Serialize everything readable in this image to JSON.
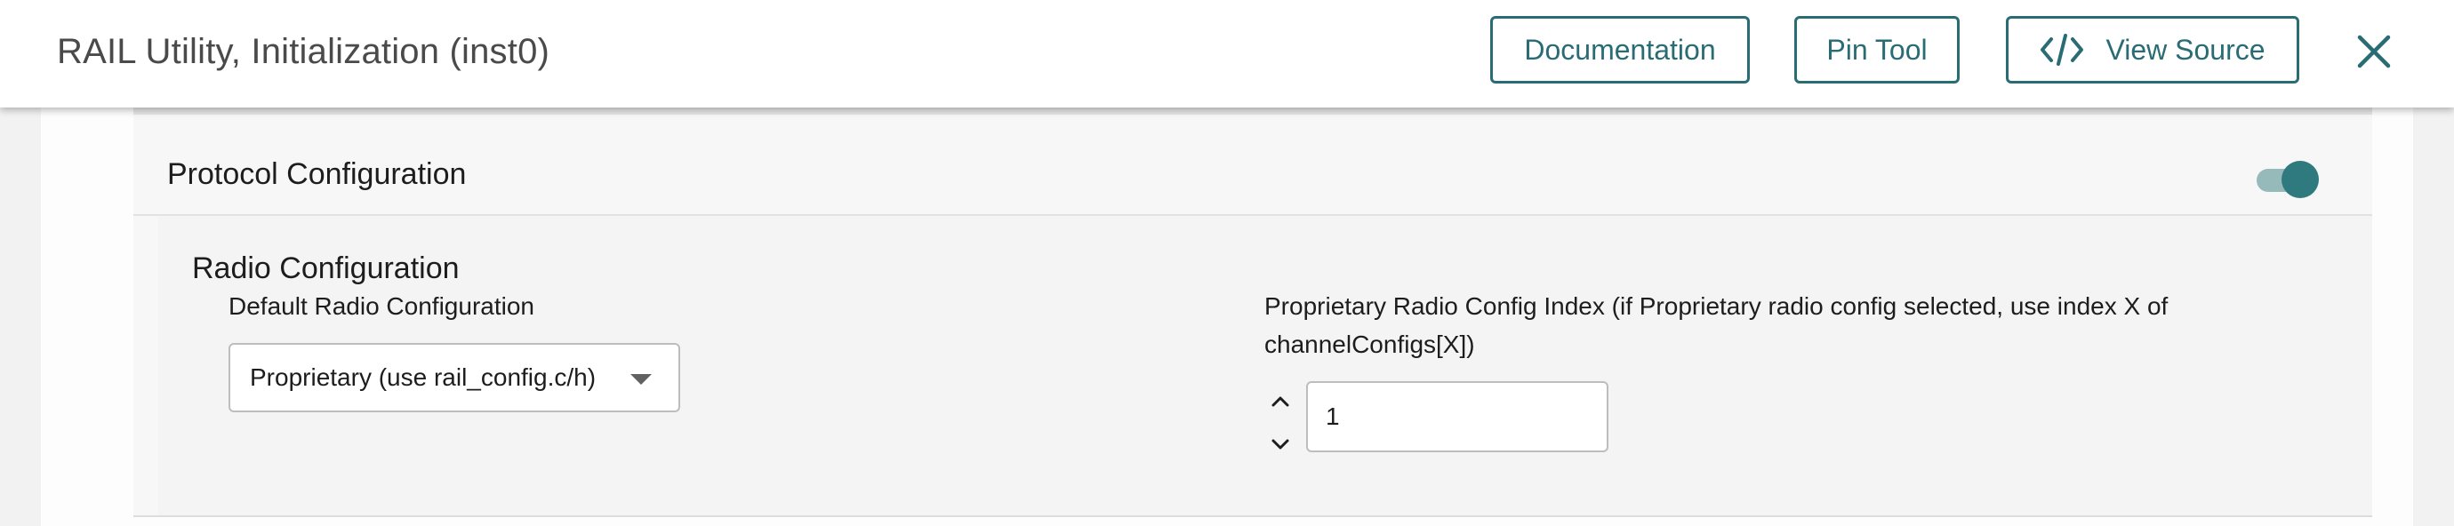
{
  "header": {
    "title": "RAIL Utility, Initialization (inst0)",
    "buttons": {
      "documentation": "Documentation",
      "pin_tool": "Pin Tool",
      "view_source": "View Source"
    },
    "icons": {
      "view_source": "code-icon",
      "close": "close-icon"
    },
    "accent_color": "#296c74"
  },
  "protocol_configuration": {
    "title": "Protocol Configuration",
    "enabled": true,
    "radio_configuration": {
      "title": "Radio Configuration",
      "default_radio": {
        "label": "Default Radio Configuration",
        "value": "Proprietary (use rail_config.c/h)"
      },
      "config_index": {
        "label_line1": "Proprietary Radio Config Index (if Proprietary radio config selected, use index X of",
        "label_line2": "channelConfigs[X])",
        "value": "1"
      }
    }
  }
}
